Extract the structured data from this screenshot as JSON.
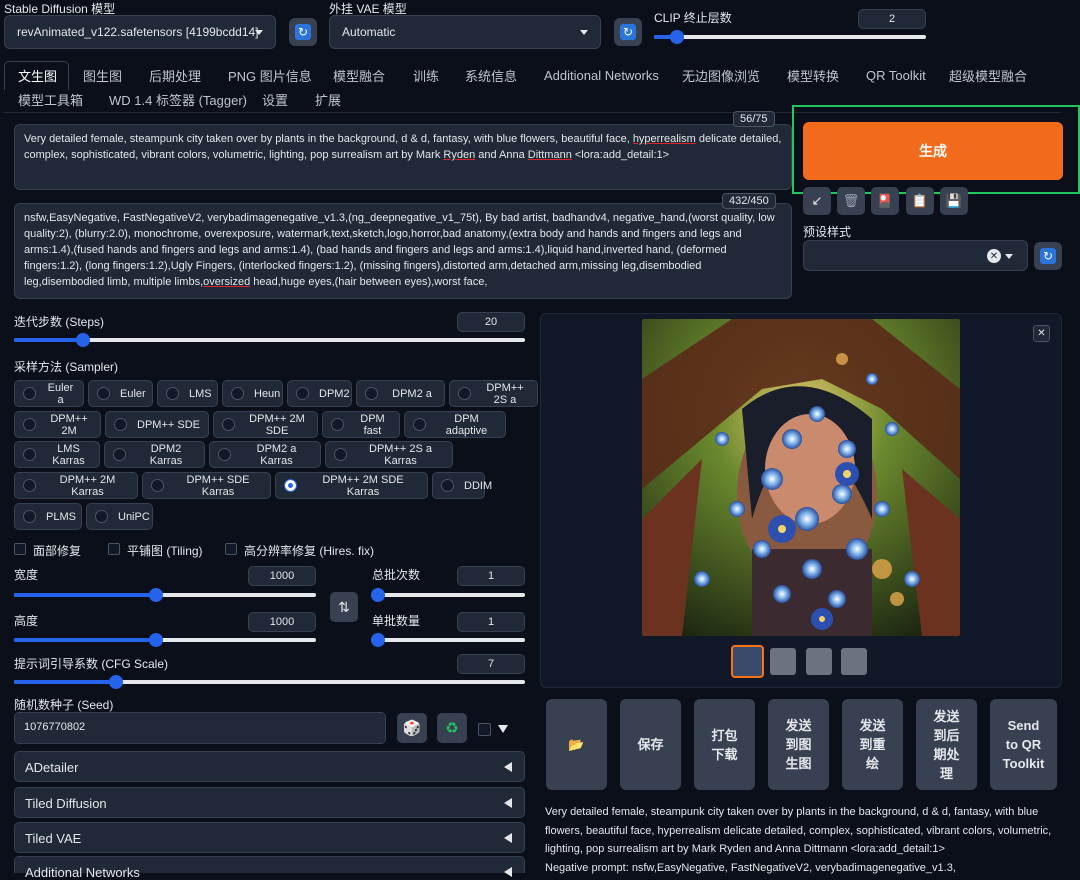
{
  "header": {
    "sd_model_label": "Stable Diffusion 模型",
    "sd_model_value": "revAnimated_v122.safetensors [4199bcdd14]",
    "vae_label": "外挂 VAE 模型",
    "vae_value": "Automatic",
    "clip_label": "CLIP 终止层数",
    "clip_value": "2",
    "clip_fraction": 0.083
  },
  "tabs": {
    "row1": [
      "文生图",
      "图生图",
      "后期处理",
      "PNG 图片信息",
      "模型融合",
      "训练",
      "系统信息",
      "Additional Networks",
      "无边图像浏览",
      "模型转换",
      "QR Toolkit",
      "超级模型融合"
    ],
    "row2": [
      "模型工具箱",
      "WD 1.4 标签器 (Tagger)",
      "设置",
      "扩展"
    ],
    "active": "文生图"
  },
  "prompt": {
    "counter": "56/75",
    "parts": [
      "Very detailed female, steampunk city taken over by plants in the background, d & d, fantasy, with blue flowers, beautiful face, ",
      "hyperrealism",
      " delicate detailed, complex, sophisticated, vibrant colors, volumetric, lighting, pop surrealism art by Mark ",
      "Ryden",
      " and Anna ",
      "Dittmann",
      " <lora:add_detail:1>"
    ]
  },
  "negative_prompt": {
    "counter": "432/450",
    "parts": [
      " nsfw,EasyNegative, FastNegativeV2, verybadimagenegative_v1.3,(ng_deepnegative_v1_75t), By bad artist, badhandv4, negative_hand,(worst quality, low quality:2), (blurry:2.0), monochrome, overexposure, watermark,text,sketch,logo,horror,bad anatomy,(extra body and hands and fingers and legs and arms:1.4),(fused hands and fingers and legs and arms:1.4), (bad hands and fingers and legs and arms:1.4),liquid hand,inverted hand, (deformed fingers:1.2), (long fingers:1.2),Ugly Fingers, (interlocked fingers:1.2), (missing fingers),distorted arm,detached arm,missing leg,disembodied leg,disembodied limb, multiple limbs,",
      "oversized",
      " head,huge eyes,(hair between eyes),worst face,"
    ]
  },
  "generate": {
    "label": "生成"
  },
  "styles": {
    "label": "预设样式",
    "value": ""
  },
  "steps": {
    "label": "迭代步数 (Steps)",
    "value": "20",
    "fraction": 0.135
  },
  "sampler": {
    "label": "采样方法 (Sampler)",
    "options": [
      "Euler a",
      "Euler",
      "LMS",
      "Heun",
      "DPM2",
      "DPM2 a",
      "DPM++ 2S a",
      "DPM++ 2M",
      "DPM++ SDE",
      "DPM++ 2M SDE",
      "DPM fast",
      "DPM adaptive",
      "LMS Karras",
      "DPM2 Karras",
      "DPM2 a Karras",
      "DPM++ 2S a Karras",
      "DPM++ 2M Karras",
      "DPM++ SDE Karras",
      "DPM++ 2M SDE Karras",
      "DDIM",
      "PLMS",
      "UniPC"
    ],
    "selected": "DPM++ 2M SDE Karras"
  },
  "checkboxes": {
    "face": "面部修复",
    "tiling": "平铺图 (Tiling)",
    "hires": "高分辨率修复 (Hires. fix)"
  },
  "width": {
    "label": "宽度",
    "value": "1000",
    "fraction": 0.47
  },
  "height": {
    "label": "高度",
    "value": "1000",
    "fraction": 0.47
  },
  "batch_count": {
    "label": "总批次数",
    "value": "1",
    "fraction": 0.0
  },
  "batch_size": {
    "label": "单批数量",
    "value": "1",
    "fraction": 0.0
  },
  "cfg": {
    "label": "提示词引导系数 (CFG Scale)",
    "value": "7",
    "fraction": 0.2
  },
  "seed": {
    "label": "随机数种子 (Seed)",
    "value": "1076770802"
  },
  "accordions": [
    "ADetailer",
    "Tiled Diffusion",
    "Tiled VAE",
    "Additional Networks"
  ],
  "actions": [
    "📂",
    "保存",
    "打包下载",
    "发送到图生图",
    "发送到重绘",
    "发送到后期处理",
    "Send to QR Toolkit"
  ],
  "info_text": "Very detailed female, steampunk city taken over by plants in the background, d & d, fantasy, with blue flowers, beautiful face, hyperrealism delicate detailed, complex, sophisticated, vibrant colors, volumetric, lighting, pop surrealism art by Mark Ryden and Anna Dittmann <lora:add_detail:1>",
  "info_text2": "Negative prompt: nsfw,EasyNegative, FastNegativeV2, verybadimagenegative_v1.3,",
  "colors": {
    "accent": "#2563eb",
    "generate": "#f97316",
    "highlight": "#22c55e"
  }
}
